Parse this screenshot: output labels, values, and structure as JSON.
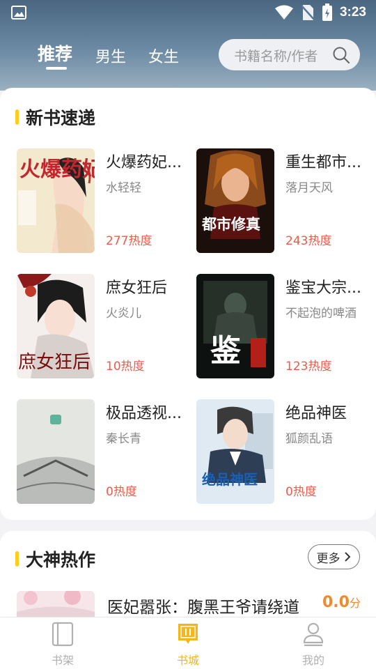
{
  "status_bar": {
    "time": "3:23"
  },
  "top_tabs": [
    {
      "label": "推荐",
      "active": true
    },
    {
      "label": "男生",
      "active": false
    },
    {
      "label": "女生",
      "active": false
    }
  ],
  "search": {
    "placeholder": "书籍名称/作者"
  },
  "new_books": {
    "title": "新书速递",
    "books": [
      {
        "title": "火爆药妃...",
        "author": "水轻轻",
        "heat": "277热度",
        "cover_text": "火爆药妃"
      },
      {
        "title": "重生都市...",
        "author": "落月天风",
        "heat": "243热度",
        "cover_text": "都市修真"
      },
      {
        "title": "庶女狂后",
        "author": "火炎儿",
        "heat": "10热度",
        "cover_text": "庶女狂后"
      },
      {
        "title": "鉴宝大宗...",
        "author": "不起泡的啤酒",
        "heat": "123热度",
        "cover_text": "鉴"
      },
      {
        "title": "极品透视...",
        "author": "秦长青",
        "heat": "0热度",
        "cover_text": ""
      },
      {
        "title": "绝品神医",
        "author": "狐颜乱语",
        "heat": "0热度",
        "cover_text": "绝品神医"
      }
    ]
  },
  "hot_works": {
    "title": "大神热作",
    "more_label": "更多",
    "first": {
      "title": "医妃嚣张：腹黑王爷请绕道",
      "score": "0.0",
      "unit": "分"
    }
  },
  "bottom_nav": [
    {
      "label": "书架",
      "active": false,
      "icon": "bookshelf-icon"
    },
    {
      "label": "书城",
      "active": true,
      "icon": "bookstore-icon"
    },
    {
      "label": "我的",
      "active": false,
      "icon": "profile-icon"
    }
  ],
  "colors": {
    "accent": "#f5b51b",
    "heat": "#f05a4a",
    "score": "#f08a2a"
  }
}
